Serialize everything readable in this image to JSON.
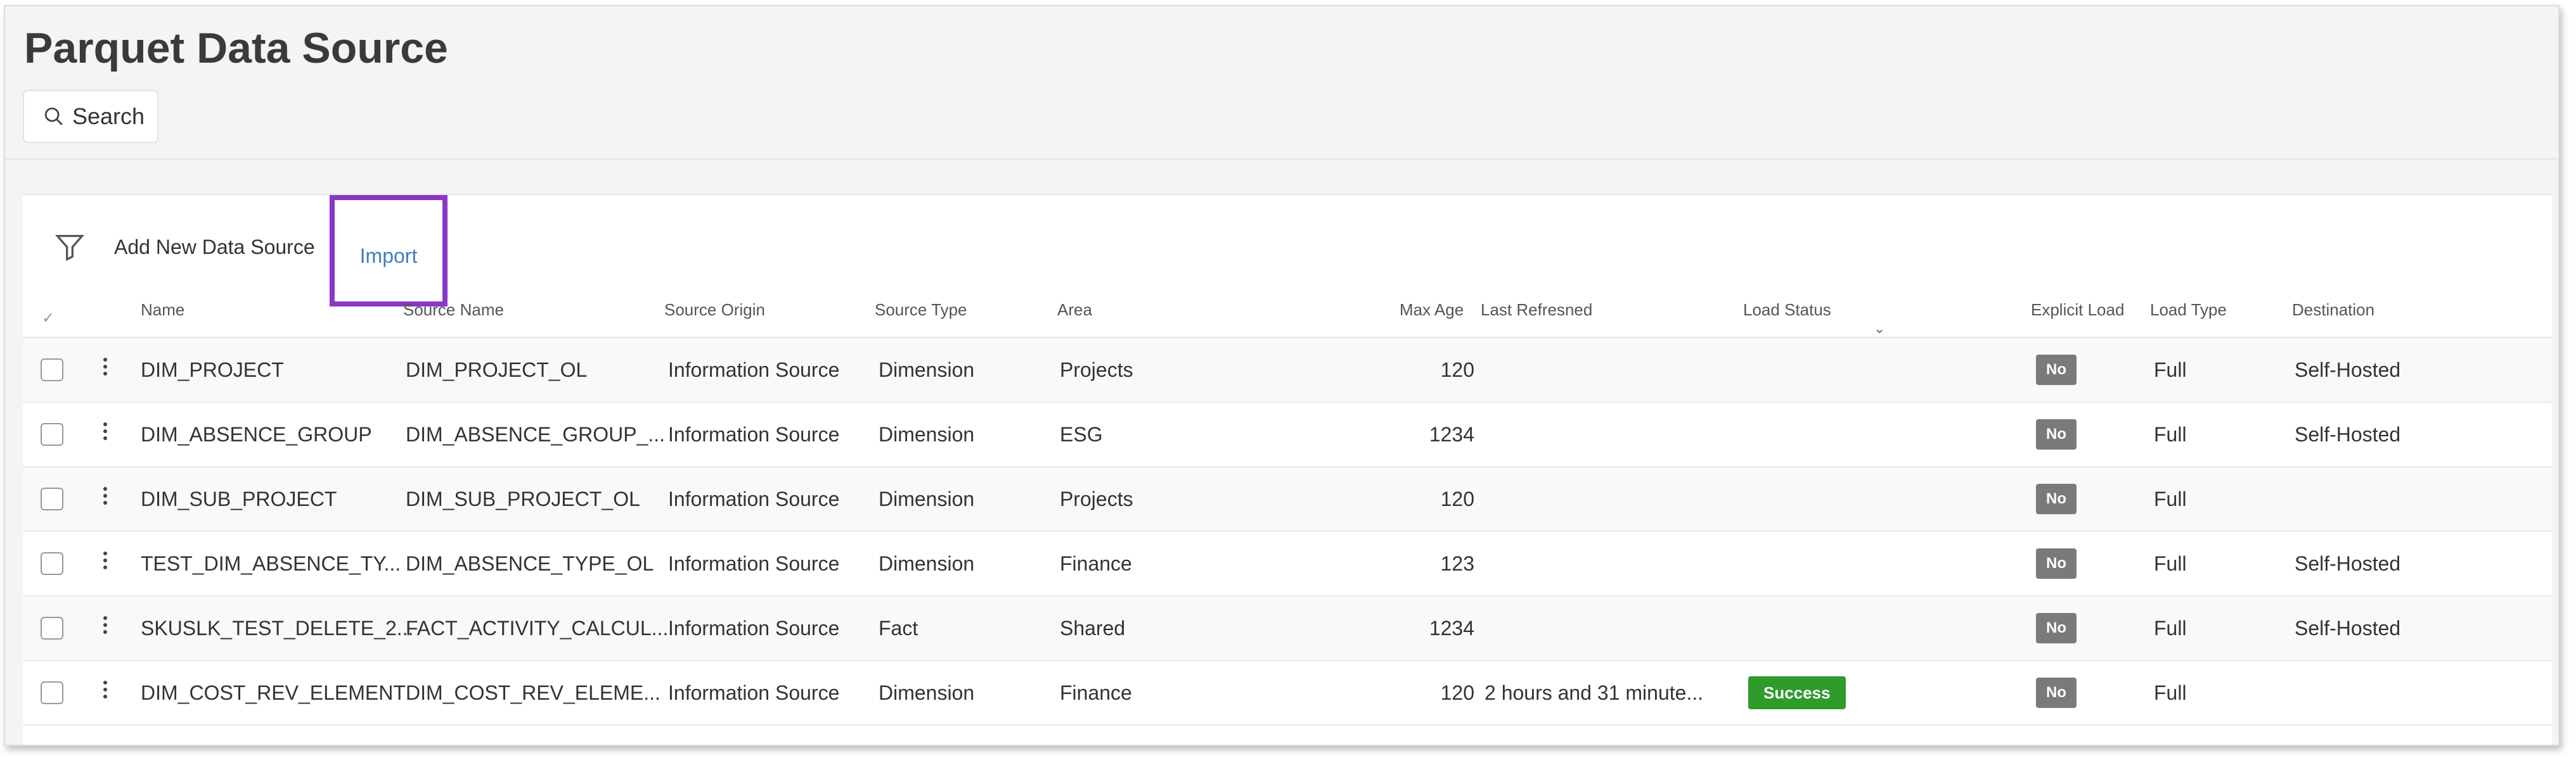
{
  "page": {
    "title": "Parquet Data Source",
    "search_label": "Search"
  },
  "toolbar": {
    "add_label": "Add New Data Source",
    "import_label": "Import"
  },
  "columns": {
    "name": "Name",
    "source_name": "Source Name",
    "source_origin": "Source Origin",
    "source_type": "Source Type",
    "area": "Area",
    "max_age": "Max Age",
    "last_refreshed": "Last Refresned",
    "load_status": "Load Status",
    "explicit_load": "Explicit Load",
    "load_type": "Load Type",
    "destination": "Destination"
  },
  "rows": [
    {
      "name": "DIM_PROJECT",
      "source_name": "DIM_PROJECT_OL",
      "source_origin": "Information Source",
      "source_type": "Dimension",
      "area": "Projects",
      "max_age": "120",
      "last_refreshed": "",
      "load_status": "",
      "explicit_load": "No",
      "load_type": "Full",
      "destination": "Self-Hosted"
    },
    {
      "name": "DIM_ABSENCE_GROUP",
      "source_name": "DIM_ABSENCE_GROUP_...",
      "source_origin": "Information Source",
      "source_type": "Dimension",
      "area": "ESG",
      "max_age": "1234",
      "last_refreshed": "",
      "load_status": "",
      "explicit_load": "No",
      "load_type": "Full",
      "destination": "Self-Hosted"
    },
    {
      "name": "DIM_SUB_PROJECT",
      "source_name": "DIM_SUB_PROJECT_OL",
      "source_origin": "Information Source",
      "source_type": "Dimension",
      "area": "Projects",
      "max_age": "120",
      "last_refreshed": "",
      "load_status": "",
      "explicit_load": "No",
      "load_type": "Full",
      "destination": ""
    },
    {
      "name": "TEST_DIM_ABSENCE_TY...",
      "source_name": "DIM_ABSENCE_TYPE_OL",
      "source_origin": "Information Source",
      "source_type": "Dimension",
      "area": "Finance",
      "max_age": "123",
      "last_refreshed": "",
      "load_status": "",
      "explicit_load": "No",
      "load_type": "Full",
      "destination": "Self-Hosted"
    },
    {
      "name": "SKUSLK_TEST_DELETE_2...",
      "source_name": "FACT_ACTIVITY_CALCUL...",
      "source_origin": "Information Source",
      "source_type": "Fact",
      "area": "Shared",
      "max_age": "1234",
      "last_refreshed": "",
      "load_status": "",
      "explicit_load": "No",
      "load_type": "Full",
      "destination": "Self-Hosted"
    },
    {
      "name": "DIM_COST_REV_ELEMENT",
      "source_name": "DIM_COST_REV_ELEME...",
      "source_origin": "Information Source",
      "source_type": "Dimension",
      "area": "Finance",
      "max_age": "120",
      "last_refreshed": "2 hours  and 31 minute...",
      "load_status": "Success",
      "explicit_load": "No",
      "load_type": "Full",
      "destination": ""
    }
  ],
  "colors": {
    "accent_highlight": "#8a37c8",
    "link": "#3c7ec0",
    "success": "#2e9b2a",
    "badge_no": "#7a7a7a"
  }
}
